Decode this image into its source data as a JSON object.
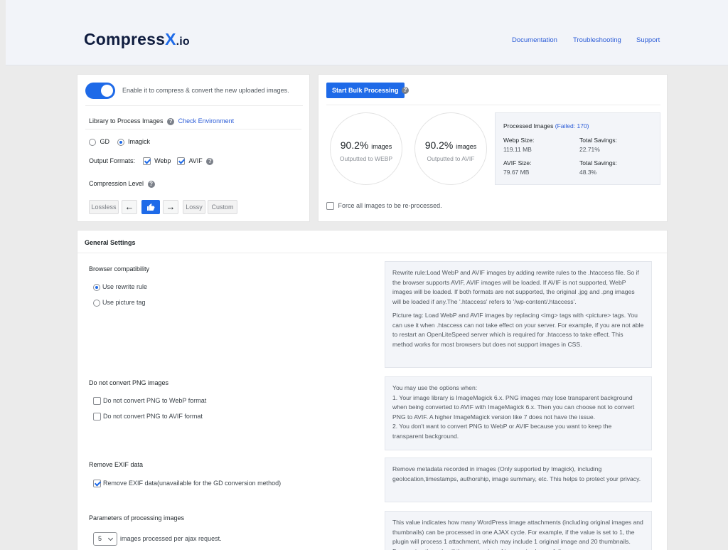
{
  "header": {
    "logo_main": "Compress",
    "logo_x": "X",
    "logo_suffix": ".io",
    "nav": [
      "Documentation",
      "Troubleshooting",
      "Support"
    ]
  },
  "auto_compress": {
    "enabled": true,
    "label": "Enable it to compress & convert the new uploaded images."
  },
  "library": {
    "label": "Library to Process Images",
    "check_env": "Check Environment",
    "options": [
      "GD",
      "Imagick"
    ],
    "selected": "Imagick"
  },
  "output_formats": {
    "label": "Output Formats:",
    "options": [
      {
        "label": "Webp",
        "checked": true
      },
      {
        "label": "AVIF",
        "checked": true
      }
    ]
  },
  "compression": {
    "label": "Compression Level",
    "lossless": "Lossless",
    "left_arrow": "←",
    "right_arrow": "→",
    "lossy": "Lossy",
    "custom": "Custom"
  },
  "bulk": {
    "button": "Start Bulk Processing",
    "webp_pct": "90.2%",
    "webp_unit": "images",
    "webp_sub": "Outputted to WEBP",
    "avif_pct": "90.2%",
    "avif_unit": "images",
    "avif_sub": "Outputted to AVIF",
    "processed_label": "Processed Images",
    "failed": "(Failed: 170)",
    "webp_size_label": "Webp Size:",
    "webp_size": "119.11 MB",
    "webp_savings_label": "Total Savings:",
    "webp_savings": "22.71%",
    "avif_size_label": "AVIF Size:",
    "avif_size": "79.67 MB",
    "avif_savings_label": "Total Savings:",
    "avif_savings": "48.3%",
    "force_label": "Force all images to be re-processed."
  },
  "general": {
    "title": "General Settings",
    "browser": {
      "label": "Browser compatibility",
      "opt1": "Use rewrite rule",
      "opt2": "Use picture tag",
      "info_p1": "Rewrite rule:Load WebP and AVIF images by adding rewrite rules to the .htaccess file. So if the browser supports AVIF, AVIF images will be loaded. If AVIF is not supported, WebP images will be loaded. If both formats are not supported, the original .jpg and .png images will be loaded if any.The '.htaccess' refers to '/wp-content/.htaccess'.",
      "info_p2": "Picture tag: Load WebP and AVIF images by replacing <img> tags with <picture> tags. You can use it when .htaccess can not take effect on your server. For example, if you are not able to restart an OpenLiteSpeed server which is required for .htaccess to take effect. This method works for most browsers but does not support images in CSS."
    },
    "png": {
      "label": "Do not convert PNG images",
      "opt1": "Do not convert PNG to WebP format",
      "opt2": "Do not convert PNG to AVIF format",
      "info_l1": "You may use the options when:",
      "info_l2": "1. Your image library is ImageMagick 6.x. PNG images may lose transparent background when being converted to AVIF with ImageMagick 6.x. Then you can choose not to convert PNG to AVIF. A higher ImageMagick version like 7 does not have the issue.",
      "info_l3": "2. You don't want to convert PNG to WebP or AVIF because you want to keep the transparent background."
    },
    "exif": {
      "label": "Remove EXIF data",
      "opt1": "Remove EXIF data(unavailable for the GD conversion method)",
      "info": "Remove metadata recorded in images (Only supported by Imagick), including geolocation,timestamps, authorship, image summary, etc. This helps to protect your privacy."
    },
    "params": {
      "label": "Parameters of processing images",
      "select_value": "5",
      "select_suffix": "images processed per ajax request.",
      "info": "This value indicates how many WordPress image attachments (including original images and thumbnails) can be processed in one AJAX cycle. For example, if the value is set to 1, the plugin will process 1 attachment, which may include 1 original image and 20 thumbnails. Decreasing the value if the processing of images is slow or fails."
    }
  }
}
